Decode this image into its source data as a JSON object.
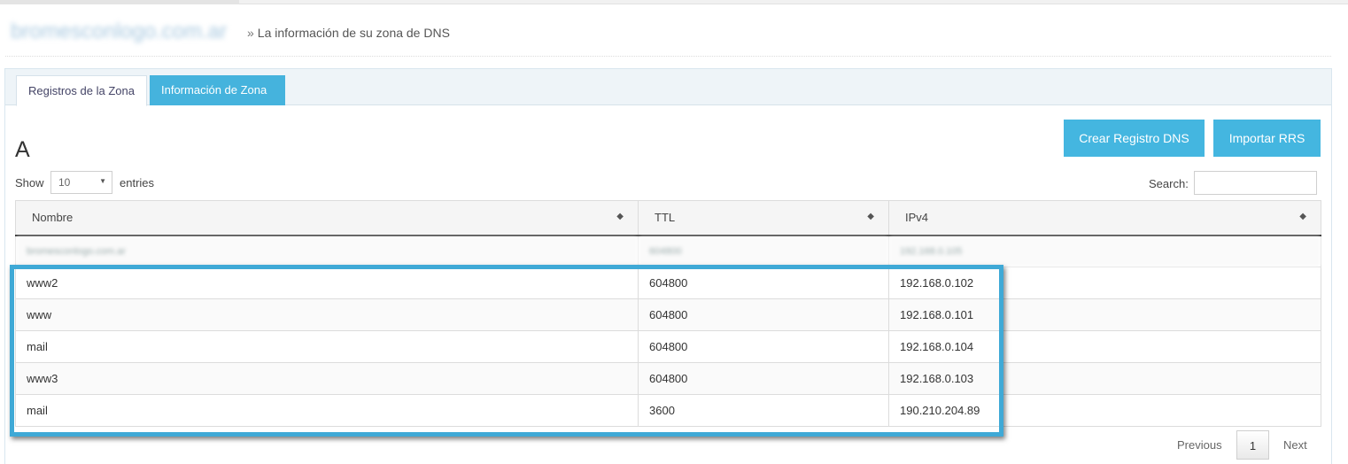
{
  "header": {
    "domain": "bromesconlogo.com.ar",
    "breadcrumb_sep": "»",
    "breadcrumb": "La información de su zona de DNS"
  },
  "tabs": [
    {
      "label": "Registros de la Zona"
    },
    {
      "label": "Información de Zona"
    }
  ],
  "toolbar": {
    "create_label": "Crear Registro DNS",
    "import_label": "Importar RRS"
  },
  "section_title": "A",
  "length_control": {
    "show_label": "Show",
    "value": "10",
    "entries_label": "entries"
  },
  "search": {
    "label": "Search:",
    "value": ""
  },
  "table": {
    "columns": [
      "Nombre",
      "TTL",
      "IPv4"
    ],
    "rows": [
      [
        "bromesconlogo.com.ar",
        "604800",
        "192.168.0.105"
      ],
      [
        "www2",
        "604800",
        "192.168.0.102"
      ],
      [
        "www",
        "604800",
        "192.168.0.101"
      ],
      [
        "mail",
        "604800",
        "192.168.0.104"
      ],
      [
        "www3",
        "604800",
        "192.168.0.103"
      ],
      [
        "mail",
        "3600",
        "190.210.204.89"
      ]
    ]
  },
  "pagination": {
    "previous": "Previous",
    "page": "1",
    "next": "Next"
  },
  "colors": {
    "accent": "#44b6e0",
    "highlight_border": "#3fa9d6"
  }
}
